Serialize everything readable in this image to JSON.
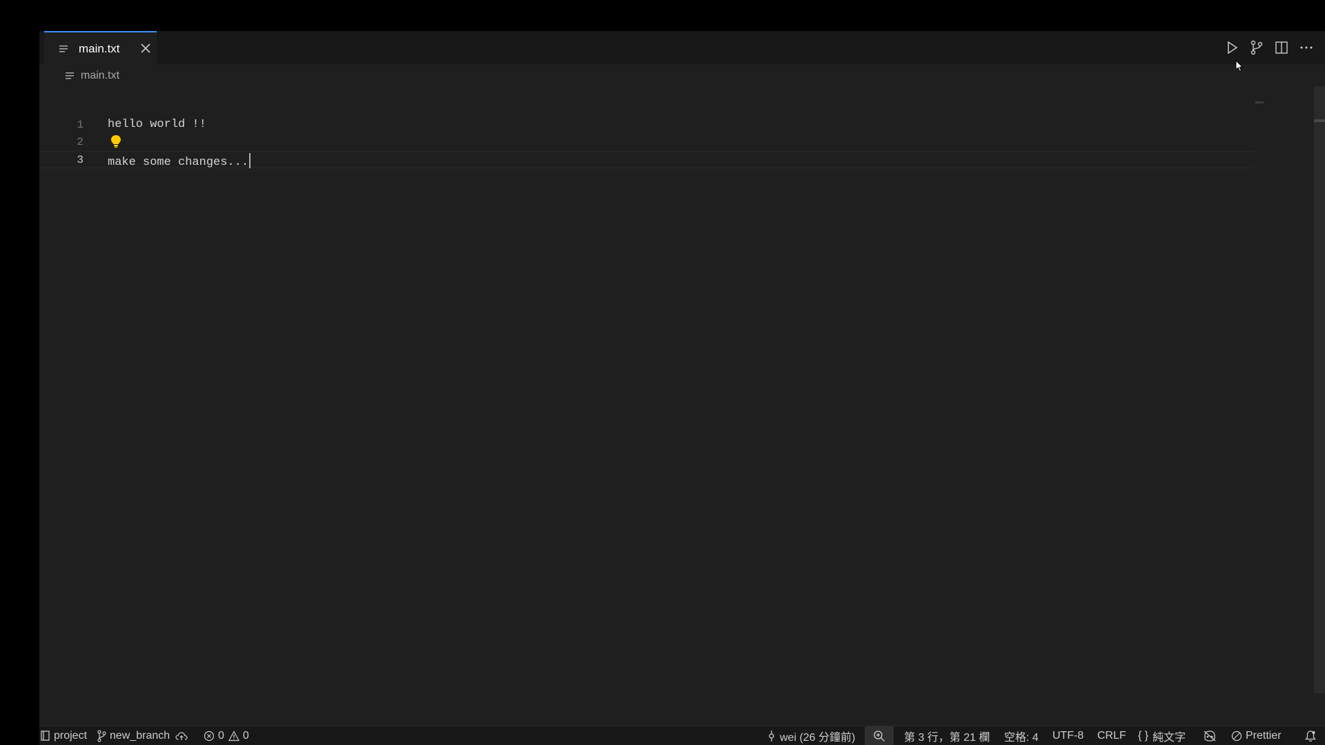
{
  "tabs": [
    {
      "label": "main.txt",
      "active": true
    }
  ],
  "breadcrumb": {
    "file": "main.txt"
  },
  "editor": {
    "lines": [
      {
        "number": "1",
        "text": "hello world !!"
      },
      {
        "number": "2",
        "text": ""
      },
      {
        "number": "3",
        "text": "make some changes..."
      }
    ],
    "current_line": 3
  },
  "status": {
    "workspace": "project",
    "branch": "new_branch",
    "errors": "0",
    "warnings": "0",
    "blame": "wei (26 分鐘前)",
    "position": "第 3 行，第 21 欄",
    "spaces": "空格: 4",
    "encoding": "UTF-8",
    "eol": "CRLF",
    "language": "純文字",
    "formatter": "Prettier"
  },
  "colors": {
    "accent": "#3794ff",
    "editor_bg": "#1f1f1f",
    "bar_bg": "#181818",
    "bulb": "#ffcc00"
  }
}
